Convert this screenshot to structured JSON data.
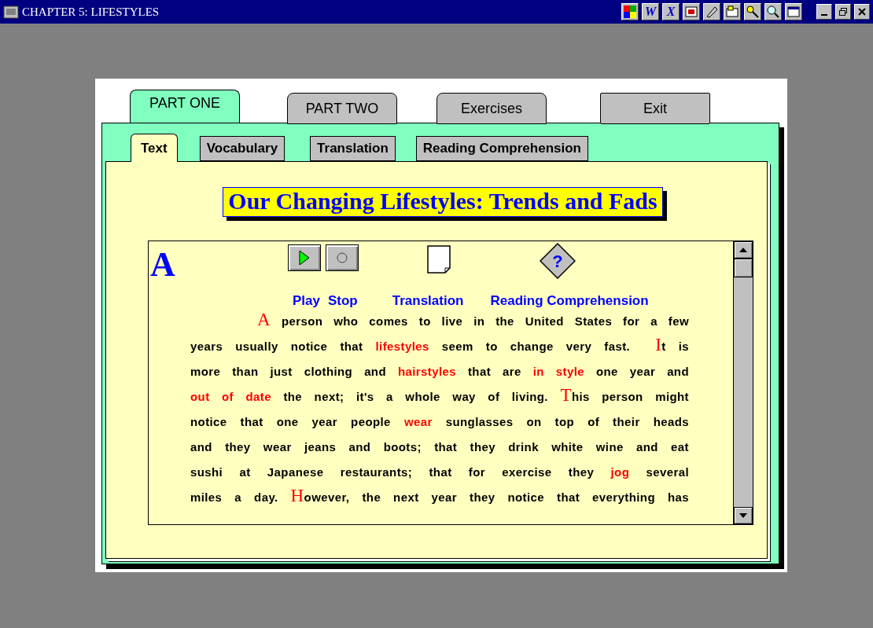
{
  "window": {
    "title": "CHAPTER 5: LIFESTYLES",
    "toolbar": [
      {
        "kind": "grid"
      },
      {
        "kind": "letter",
        "label": "W"
      },
      {
        "kind": "letter",
        "label": "X"
      },
      {
        "kind": "screen"
      },
      {
        "kind": "pen"
      },
      {
        "kind": "tray"
      },
      {
        "kind": "key"
      },
      {
        "kind": "magnifier"
      },
      {
        "kind": "frame"
      }
    ]
  },
  "main_tabs": [
    {
      "label": "PART ONE",
      "selected": true,
      "kind": "tab"
    },
    {
      "label": "PART TWO",
      "selected": false,
      "kind": "tab"
    },
    {
      "label": "Exercises",
      "selected": false,
      "kind": "tab"
    },
    {
      "label": "Exit",
      "selected": false,
      "kind": "button"
    }
  ],
  "sub_tabs": [
    {
      "label": "Text",
      "selected": true
    },
    {
      "label": "Vocabulary",
      "selected": false
    },
    {
      "label": "Translation",
      "selected": false
    },
    {
      "label": "Reading Comprehension",
      "selected": false
    }
  ],
  "heading": "Our Changing Lifestyles: Trends and Fads",
  "section_letter": "A",
  "tools": [
    {
      "kind": "play",
      "label": "Play"
    },
    {
      "kind": "stop",
      "label": "Stop"
    },
    {
      "kind": "translation",
      "label": "Translation"
    },
    {
      "kind": "help",
      "label": "Reading Comprehension",
      "glyph": "?"
    }
  ],
  "passage": [
    [
      {
        "kind": "initial",
        "text": "A"
      },
      {
        "kind": "plain",
        "text": " person who comes to live in the United States for a few"
      }
    ],
    [
      {
        "kind": "plain",
        "text": "years usually notice that "
      },
      {
        "kind": "vocab",
        "text": "lifestyles"
      },
      {
        "kind": "plain",
        "text": " seem to change very fast.  "
      },
      {
        "kind": "initial",
        "text": "I"
      },
      {
        "kind": "plain",
        "text": "t is"
      }
    ],
    [
      {
        "kind": "plain",
        "text": "more than just clothing and "
      },
      {
        "kind": "vocab",
        "text": "hairstyles"
      },
      {
        "kind": "plain",
        "text": " that are "
      },
      {
        "kind": "vocab",
        "text": "in style"
      },
      {
        "kind": "plain",
        "text": " one year and"
      }
    ],
    [
      {
        "kind": "vocab",
        "text": "out of date"
      },
      {
        "kind": "plain",
        "text": " the next; it's a whole way of living. "
      },
      {
        "kind": "initial",
        "text": "T"
      },
      {
        "kind": "plain",
        "text": "his person might"
      }
    ],
    [
      {
        "kind": "plain",
        "text": "notice that one year people "
      },
      {
        "kind": "vocab",
        "text": "wear"
      },
      {
        "kind": "plain",
        "text": " sunglasses on top of their heads"
      }
    ],
    [
      {
        "kind": "plain",
        "text": "and they wear jeans and boots; that they drink white wine and eat"
      }
    ],
    [
      {
        "kind": "plain",
        "text": "sushi at Japanese restaurants; that for exercise they "
      },
      {
        "kind": "vocab",
        "text": "jog"
      },
      {
        "kind": "plain",
        "text": " several"
      }
    ],
    [
      {
        "kind": "plain",
        "text": "miles a day. "
      },
      {
        "kind": "initial",
        "text": "H"
      },
      {
        "kind": "plain",
        "text": "owever, the next year they notice that everything has"
      }
    ]
  ]
}
